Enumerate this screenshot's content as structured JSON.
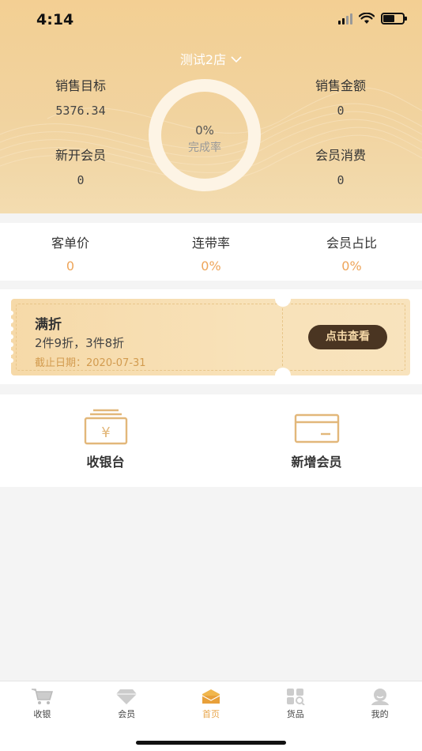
{
  "status_bar": {
    "time": "4:14"
  },
  "store": {
    "name": "测试2店"
  },
  "stats": {
    "sales_target": {
      "label": "销售目标",
      "value": "5376.34"
    },
    "sales_amount": {
      "label": "销售金额",
      "value": "0"
    },
    "new_members": {
      "label": "新开会员",
      "value": "0"
    },
    "member_spend": {
      "label": "会员消费",
      "value": "0"
    }
  },
  "completion": {
    "value": "0%",
    "label": "完成率",
    "progress": 0
  },
  "metrics": [
    {
      "label": "客单价",
      "value": "0"
    },
    {
      "label": "连带率",
      "value": "0%"
    },
    {
      "label": "会员占比",
      "value": "0%"
    }
  ],
  "coupon": {
    "title": "满折",
    "description": "2件9折，3件8折",
    "deadline": "截止日期：2020-07-31",
    "button": "点击查看"
  },
  "actions": [
    {
      "label": "收银台",
      "icon": "cash-register-icon"
    },
    {
      "label": "新增会员",
      "icon": "member-card-icon"
    }
  ],
  "tabs": [
    {
      "label": "收银",
      "icon": "cart-icon",
      "active": false
    },
    {
      "label": "会员",
      "icon": "diamond-icon",
      "active": false
    },
    {
      "label": "首页",
      "icon": "home-icon",
      "active": true
    },
    {
      "label": "货品",
      "icon": "goods-icon",
      "active": false
    },
    {
      "label": "我的",
      "icon": "profile-icon",
      "active": false
    }
  ],
  "colors": {
    "header_bg": "#f3cf93",
    "accent": "#eea55a",
    "button_bg": "#4a3522",
    "tab_active": "#e8a54a"
  }
}
